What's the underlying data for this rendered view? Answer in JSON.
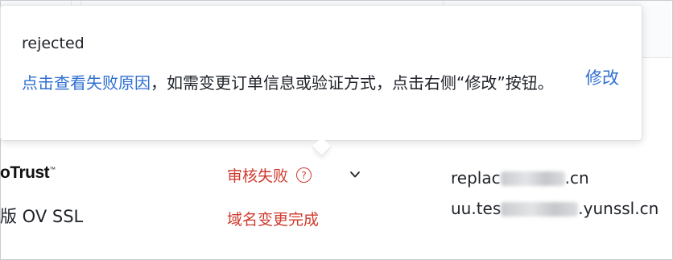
{
  "popover": {
    "title": "rejected",
    "link_text": "点击查看失败原因",
    "message": "，如需变更订单信息或验证方式，点击右侧“修改”按钮。",
    "edit_label": "修改"
  },
  "row": {
    "brand": "oTrust",
    "brand_tm": "™",
    "product": "版 OV SSL",
    "status": "审核失败",
    "help_glyph": "?",
    "sub_status": "域名变更完成",
    "domains": [
      {
        "prefix": "replac",
        "suffix": ".cn"
      },
      {
        "prefix": "uu.tes",
        "suffix": ".yunssl.cn"
      }
    ]
  },
  "colors": {
    "link": "#2f6fd1",
    "error": "#d03a2e",
    "text": "#1f2329",
    "border": "#dfe1e5"
  },
  "icons": [
    "help-icon",
    "chevron-down-icon"
  ]
}
